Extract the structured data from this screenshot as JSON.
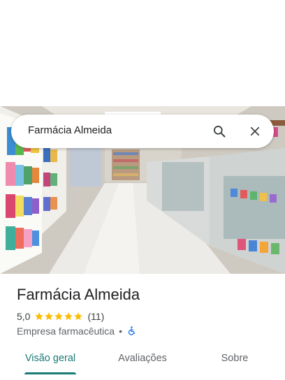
{
  "search": {
    "query": "Farmácia Almeida",
    "search_icon": "search-icon",
    "close_icon": "close-icon"
  },
  "place": {
    "name": "Farmácia Almeida",
    "rating": "5,0",
    "stars": 5,
    "review_count": "(11)",
    "category": "Empresa farmacêutica",
    "separator": "•",
    "accessibility_icon": "wheelchair-icon"
  },
  "tabs": [
    {
      "label": "Visão geral",
      "selected": true
    },
    {
      "label": "Avaliações",
      "selected": false
    },
    {
      "label": "Sobre",
      "selected": false
    }
  ],
  "colors": {
    "accent": "#1a7a74",
    "star": "#fbbc04",
    "accessibility": "#1a73e8"
  }
}
